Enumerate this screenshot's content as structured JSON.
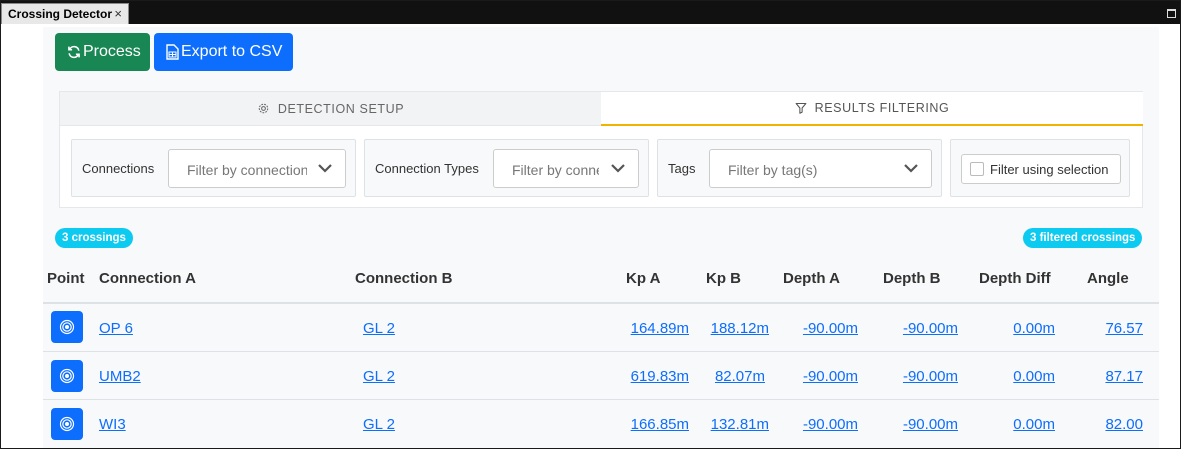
{
  "window": {
    "tab_title": "Crossing Detector",
    "close_glyph": "×"
  },
  "toolbar": {
    "process_label": "Process",
    "export_label": "Export to CSV"
  },
  "tabs": [
    {
      "label": "DETECTION SETUP",
      "icon": "gear-icon",
      "active": false
    },
    {
      "label": "RESULTS FILTERING",
      "icon": "filter-icon",
      "active": true
    }
  ],
  "filters": {
    "connections": {
      "label": "Connections",
      "placeholder": "Filter by connection(s)"
    },
    "connection_types": {
      "label": "Connection Types",
      "placeholder": "Filter by connection type(s)"
    },
    "tags": {
      "label": "Tags",
      "placeholder": "Filter by tag(s)"
    },
    "selection": {
      "label": "Filter using selection",
      "checked": false
    }
  },
  "badges": {
    "crossings": "3 crossings",
    "filtered": "3 filtered crossings"
  },
  "table": {
    "headers": [
      "Point",
      "Connection A",
      "Connection B",
      "Kp A",
      "Kp B",
      "Depth A",
      "Depth B",
      "Depth Diff",
      "Angle"
    ],
    "rows": [
      [
        "OP 6",
        "GL 2",
        "164.89m",
        "188.12m",
        "-90.00m",
        "-90.00m",
        "0.00m",
        "76.57"
      ],
      [
        "UMB2",
        "GL 2",
        "619.83m",
        "82.07m",
        "-90.00m",
        "-90.00m",
        "0.00m",
        "87.17"
      ],
      [
        "WI3",
        "GL 2",
        "166.85m",
        "132.81m",
        "-90.00m",
        "-90.00m",
        "0.00m",
        "82.00"
      ]
    ]
  },
  "colors": {
    "process": "#198754",
    "export": "#0d6efd",
    "badge": "#0dcaf0",
    "active_tab_underline": "#f0b400"
  }
}
